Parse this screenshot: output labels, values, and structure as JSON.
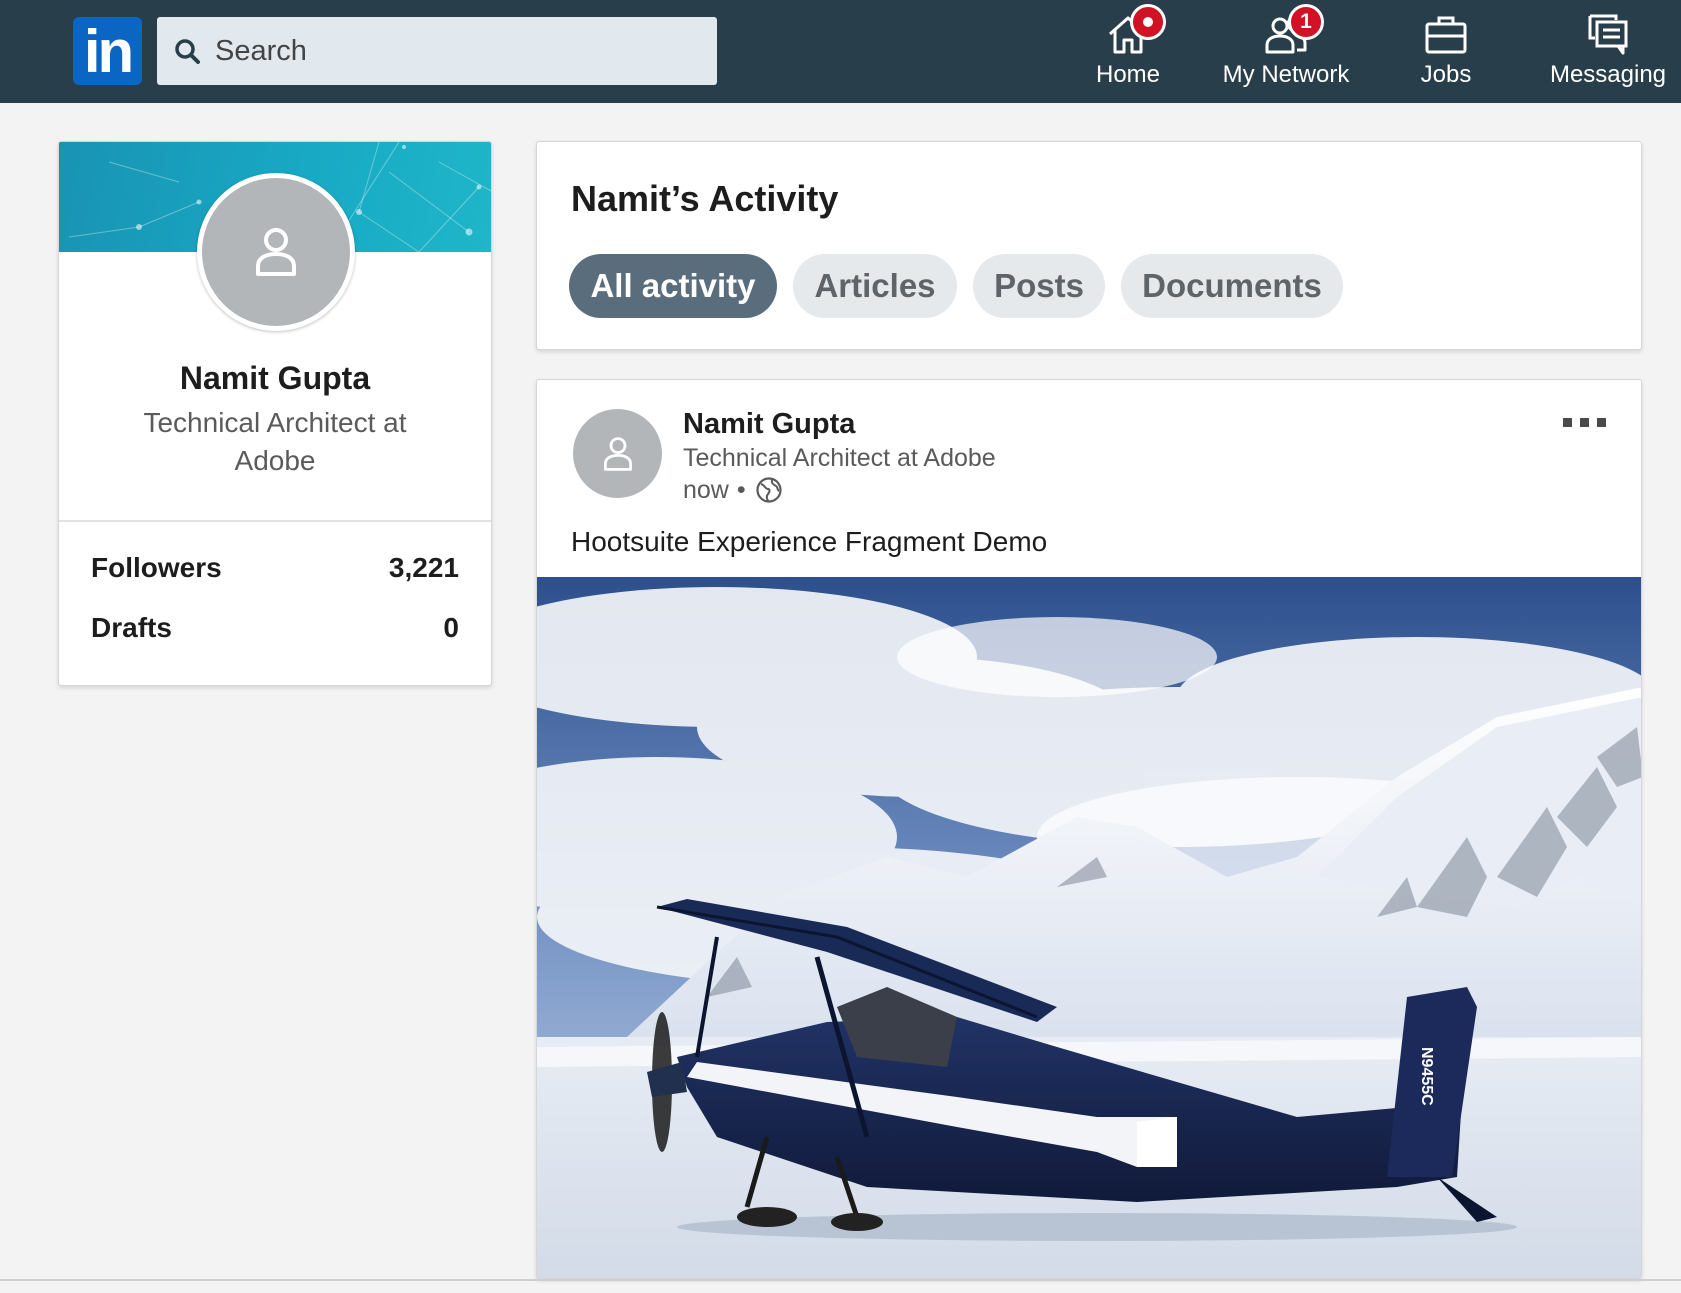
{
  "nav": {
    "logo_text": "in",
    "search_placeholder": "Search",
    "items": [
      {
        "label": "Home",
        "icon": "home-icon",
        "badge": ""
      },
      {
        "label": "My Network",
        "icon": "network-icon",
        "badge": "1"
      },
      {
        "label": "Jobs",
        "icon": "briefcase-icon",
        "badge": ""
      },
      {
        "label": "Messaging",
        "icon": "messaging-icon",
        "badge": ""
      }
    ]
  },
  "profile": {
    "name": "Namit Gupta",
    "headline": "Technical Architect at Adobe",
    "stats": [
      {
        "label": "Followers",
        "value": "3,221"
      },
      {
        "label": "Drafts",
        "value": "0"
      }
    ]
  },
  "activity": {
    "title": "Namit’s Activity",
    "tabs": [
      {
        "label": "All activity",
        "active": true
      },
      {
        "label": "Articles",
        "active": false
      },
      {
        "label": "Posts",
        "active": false
      },
      {
        "label": "Documents",
        "active": false
      }
    ]
  },
  "post": {
    "author": "Namit Gupta",
    "headline": "Technical Architect at Adobe",
    "time": "now",
    "separator": "•",
    "text": "Hootsuite Experience Fragment Demo",
    "image_alt": "Blue and white ski plane parked on snow in front of snowy mountains under a cloudy blue sky",
    "tail_number": "N9455C"
  },
  "colors": {
    "topbar": "#283e4a",
    "brand": "#0a66c2",
    "badge": "#d11124",
    "active_pill": "#596d7c",
    "pill": "#e6e9ec",
    "banner": "#18a9c4",
    "avatar_bg": "#b3b6b9"
  }
}
